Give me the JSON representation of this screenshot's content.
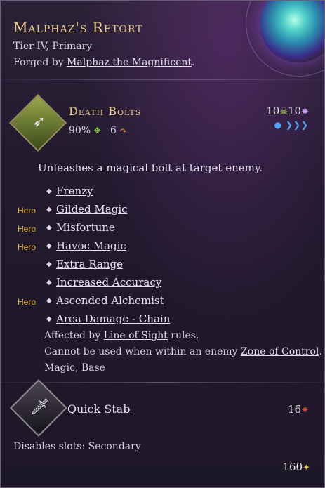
{
  "item": {
    "title": "Malphaz's Retort",
    "tier_line": "Tier IV, Primary",
    "forged_prefix": "Forged by ",
    "forger": "Malphaz the Magnificent",
    "forged_suffix": "."
  },
  "skill": {
    "name": "Death Bolts",
    "accuracy": "90%",
    "range": "6",
    "cost_a": "10",
    "cost_b": "10",
    "icon": "arrow-volley-icon",
    "description": "Unleashes a magical bolt at target enemy.",
    "upgrades": [
      {
        "hero": "",
        "label": "Frenzy"
      },
      {
        "hero": "Hero",
        "label": "Gilded Magic"
      },
      {
        "hero": "Hero",
        "label": "Misfortune"
      },
      {
        "hero": "Hero",
        "label": "Havoc Magic"
      },
      {
        "hero": "",
        "label": "Extra Range"
      },
      {
        "hero": "",
        "label": "Increased Accuracy"
      },
      {
        "hero": "Hero",
        "label": "Ascended Alchemist"
      },
      {
        "hero": "",
        "label": "Area Damage - Chain"
      }
    ],
    "note1_prefix": "Affected by ",
    "note1_link": "Line of Sight",
    "note1_suffix": " rules.",
    "note2_prefix": "Cannot be used when within an enemy ",
    "note2_link": "Zone of Control",
    "note2_suffix": ".",
    "tags": "Magic, Base"
  },
  "skill2": {
    "name": "Quick Stab",
    "cost": "16",
    "icon": "dagger-icon"
  },
  "footer": {
    "disables": "Disables slots: Secondary",
    "price": "160"
  },
  "colors": {
    "title_gold": "#e8c98a",
    "hero_orange": "#e8b030",
    "skull_green": "#a6e04a"
  }
}
